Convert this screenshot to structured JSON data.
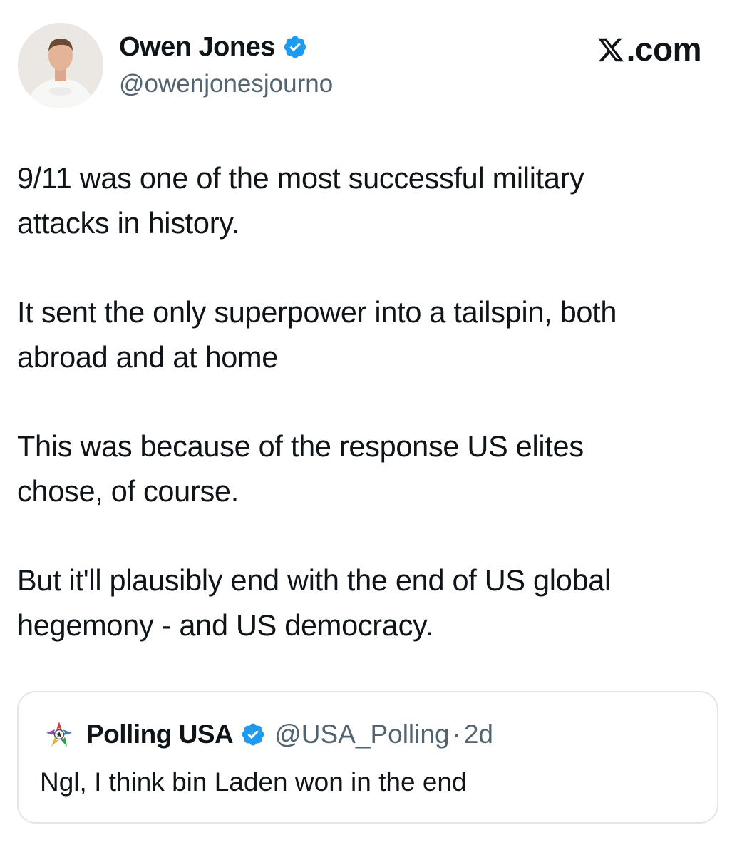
{
  "author": {
    "display_name": "Owen Jones",
    "handle": "@owenjonesjourno",
    "verified_icon": "verified-badge-icon",
    "avatar": "profile-photo"
  },
  "source": {
    "label": ".com",
    "logo_icon": "x-logo-icon"
  },
  "tweet": {
    "paragraphs": [
      "9/11 was one of the most successful military\nattacks in history.",
      "It sent the only superpower into a tailspin, both\nabroad and at home",
      "This was because of the response US elites\nchose, of course.",
      "But it'll plausibly end with the end of US global\nhegemony - and US democracy."
    ]
  },
  "quoted_tweet": {
    "display_name": "Polling USA",
    "handle": "@USA_Polling",
    "separator": "·",
    "time": "2d",
    "text": "Ngl, I think bin Laden won in the end",
    "avatar_icon": "polling-usa-logo-icon"
  },
  "colors": {
    "text": "#0f1419",
    "secondary": "#536471",
    "verified": "#1d9bf0",
    "card_border": "#e1e6ea"
  }
}
